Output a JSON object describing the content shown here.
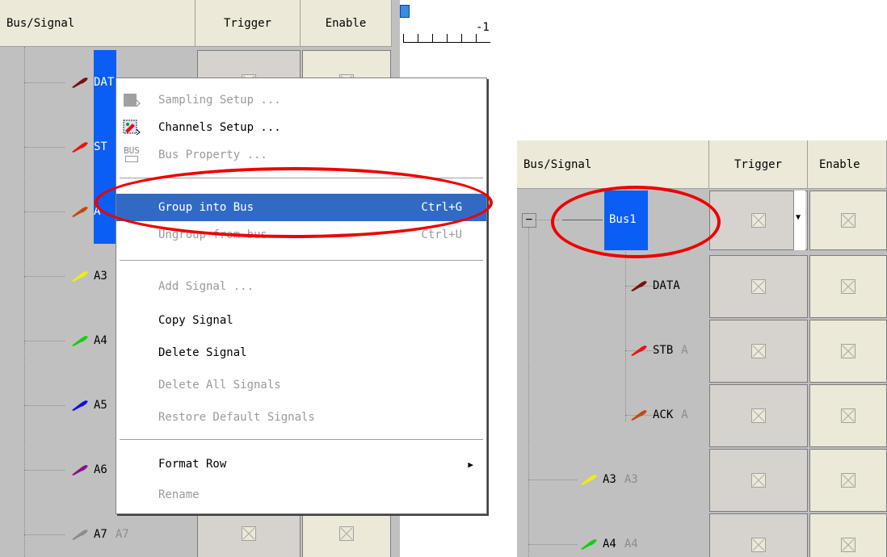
{
  "left": {
    "header": {
      "bus_signal": "Bus/Signal",
      "trigger": "Trigger",
      "enable": "Enable",
      "ruler": "-1"
    },
    "signals": [
      {
        "name": "DAT",
        "alias": "",
        "color": "#7a1010"
      },
      {
        "name": "ST",
        "alias": "",
        "color": "#ee1111"
      },
      {
        "name": "A",
        "alias": "",
        "color": "#c04a10"
      },
      {
        "name": "A3",
        "alias": "",
        "color": "#f0f000"
      },
      {
        "name": "A4",
        "alias": "",
        "color": "#10d010"
      },
      {
        "name": "A5",
        "alias": "",
        "color": "#1010dd"
      },
      {
        "name": "A6",
        "alias": "",
        "color": "#8a108a"
      },
      {
        "name": "A7",
        "alias": "A7",
        "color": "#8c8c8c"
      }
    ]
  },
  "context_menu": {
    "items": [
      {
        "label": "Sampling Setup ...",
        "shortcut": "",
        "disabled": true,
        "icon": "sampling-setup-icon"
      },
      {
        "label": "Channels Setup ...",
        "shortcut": "",
        "disabled": false,
        "icon": "channels-setup-icon"
      },
      {
        "label": "Bus Property ...",
        "shortcut": "",
        "disabled": true,
        "icon": "bus-property-icon"
      },
      {
        "label": "Group into Bus",
        "shortcut": "Ctrl+G",
        "disabled": false,
        "highlighted": true
      },
      {
        "label": "Ungroup from bus",
        "shortcut": "Ctrl+U",
        "disabled": true
      },
      {
        "label": "Add Signal ...",
        "shortcut": "",
        "disabled": true
      },
      {
        "label": "Copy Signal",
        "shortcut": "",
        "disabled": false
      },
      {
        "label": "Delete Signal",
        "shortcut": "",
        "disabled": false
      },
      {
        "label": "Delete All Signals",
        "shortcut": "",
        "disabled": true
      },
      {
        "label": "Restore Default Signals",
        "shortcut": "",
        "disabled": true
      },
      {
        "label": "Format Row",
        "shortcut": "",
        "disabled": false,
        "submenu": true
      },
      {
        "label": "Rename",
        "shortcut": "",
        "disabled": true
      }
    ],
    "bus_icon_text": "BUS"
  },
  "right": {
    "header": {
      "bus_signal": "Bus/Signal",
      "trigger": "Trigger",
      "enable": "Enable"
    },
    "bus": {
      "name": "Bus1",
      "collapse": "−"
    },
    "signals": [
      {
        "name": "DATA",
        "alias": "",
        "color": "#7a1010"
      },
      {
        "name": "STB",
        "alias": "A",
        "color": "#ee1111"
      },
      {
        "name": "ACK",
        "alias": "A",
        "color": "#c04a10"
      },
      {
        "name": "A3",
        "alias": "A3",
        "color": "#f0f000"
      },
      {
        "name": "A4",
        "alias": "A4",
        "color": "#10d010"
      }
    ]
  },
  "colors": {
    "highlight": "#316ac5",
    "selection": "#0a5ef5",
    "annotation": "#ee0000"
  }
}
